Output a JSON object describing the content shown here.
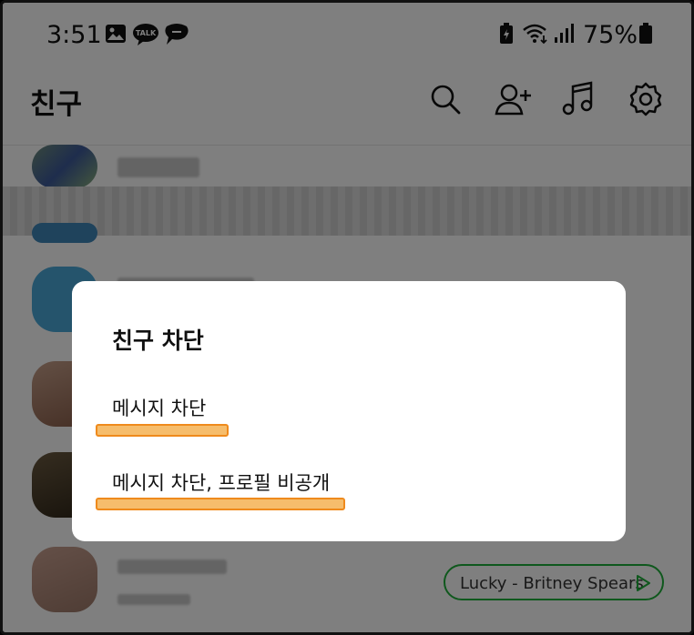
{
  "status_bar": {
    "time": "3:51",
    "notif_icons": [
      "gallery-icon",
      "kakaotalk-icon",
      "chat-bubble-icon"
    ],
    "talk_text": "TALK",
    "system_icons": [
      "battery-saver-icon",
      "wifi-icon",
      "signal-icon"
    ],
    "battery_percent": "75%"
  },
  "header": {
    "title": "친구",
    "icons": [
      "search-icon",
      "add-friend-icon",
      "music-icon",
      "settings-icon"
    ]
  },
  "friend_list": {
    "music_status": "Lucky - Britney Spears",
    "music_icon": "play-icon"
  },
  "dialog": {
    "title": "친구 차단",
    "options": [
      {
        "label": "메시지 차단",
        "highlighted": true
      },
      {
        "label": "메시지 차단, 프로필 비공개",
        "highlighted": true
      }
    ],
    "highlight_color": "#f6bd6c",
    "highlight_border": "#ef8a1c"
  },
  "colors": {
    "music_border": "#1eb13a",
    "overlay": "rgba(0,0,0,0.5)"
  }
}
